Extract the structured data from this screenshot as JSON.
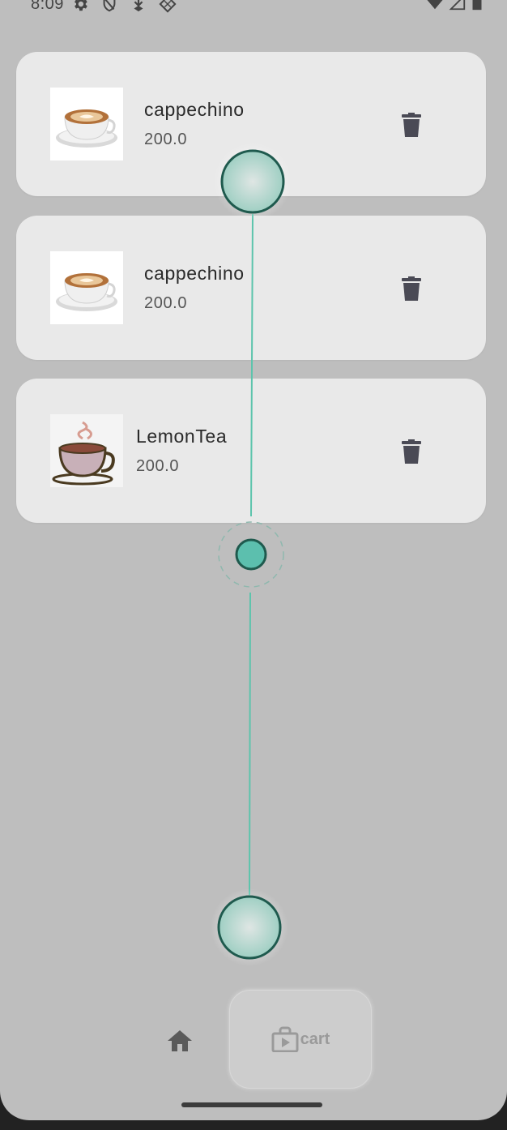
{
  "status_bar": {
    "time": "8:09",
    "left_icons": [
      "gear-icon",
      "shield-icon",
      "download-icon",
      "diamond-icon"
    ],
    "right_icons": [
      "wifi-icon",
      "signal-icon",
      "battery-icon"
    ]
  },
  "cart_items": [
    {
      "name": "cappechino",
      "price": "200.0",
      "image": "cappuccino-image"
    },
    {
      "name": "cappechino",
      "price": "200.0",
      "image": "cappuccino-image"
    },
    {
      "name": "LemonTea",
      "price": "200.0",
      "image": "tea-cup-image"
    }
  ],
  "bottom_nav": {
    "home_icon": "home-icon",
    "cart_icon": "shopping-bag-play-icon",
    "cart_label": "cart"
  },
  "colors": {
    "background": "#bebebe",
    "card": "#e9e9e9",
    "accent_teal": "#5cc4ac",
    "teal_dark": "#1f5a4e"
  }
}
